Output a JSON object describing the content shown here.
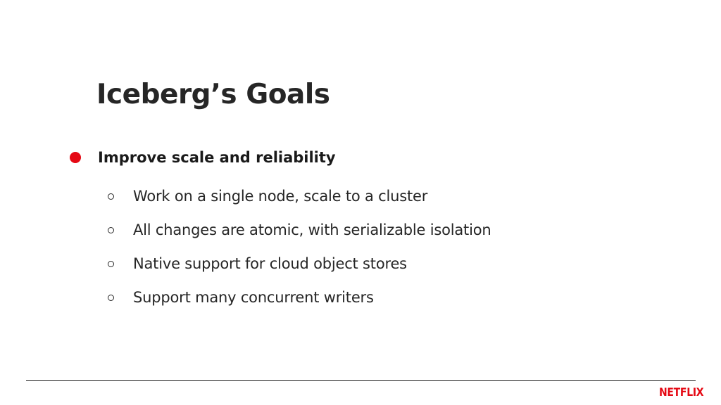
{
  "slide": {
    "title": "Iceberg’s Goals",
    "bullet": {
      "text": "Improve scale and reliability",
      "color": "#e50914",
      "sub_items": [
        "Work on a single node, scale to a cluster",
        "All changes are atomic, with serializable isolation",
        "Native support for cloud object stores",
        "Support many concurrent writers"
      ]
    },
    "logo": {
      "text": "NETFLIX",
      "color": "#e50914"
    }
  }
}
